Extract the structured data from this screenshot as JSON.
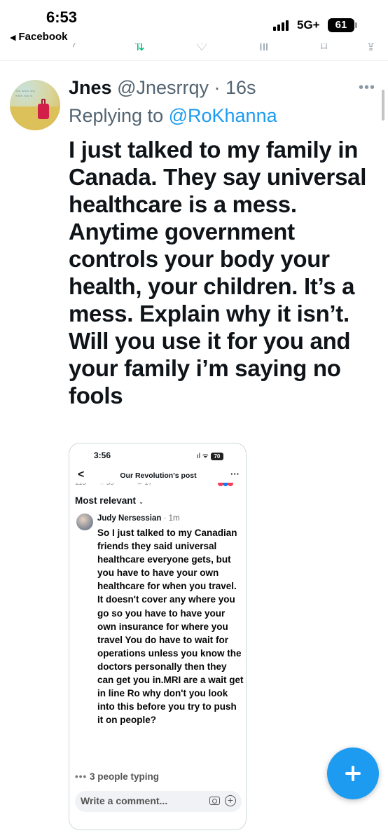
{
  "status_bar": {
    "time": "6:53",
    "back_app": "Facebook",
    "network": "5G+",
    "battery": "61"
  },
  "tweet": {
    "display_name": "Jnes",
    "handle_time": "@Jnesrrqy · 16s",
    "replying_prefix": "Replying to ",
    "replying_to": "@RoKhanna",
    "text": "I just talked to my family in Canada. They say universal healthcare is a mess. Anytime government controls your body your health, your children. It’s a mess. Explain why it isn’t. Will you use it for you and your family i’m saying no fools"
  },
  "embedded_screenshot": {
    "time": "3:56",
    "battery": "70",
    "page_title": "Our Revolution's post",
    "sort_label": "Most relevant",
    "comment": {
      "author": "Judy Nersessian",
      "time_ago": " · 1m",
      "text": "So I just talked to my Canadian friends they said universal healthcare everyone gets, but you have to have your own healthcare for when you travel. It doesn't cover any where you go so you have to have your own insurance for where you travel You do have to wait for operations unless you know the doctors personally then they can get you in.MRI  are a wait get in line Ro why don't you look into this before you try to push it on people?"
    },
    "typing_indicator": "3 people typing",
    "comment_placeholder": "Write a comment..."
  },
  "colors": {
    "link_blue": "#1d9bf0",
    "muted_gray": "#536471"
  }
}
